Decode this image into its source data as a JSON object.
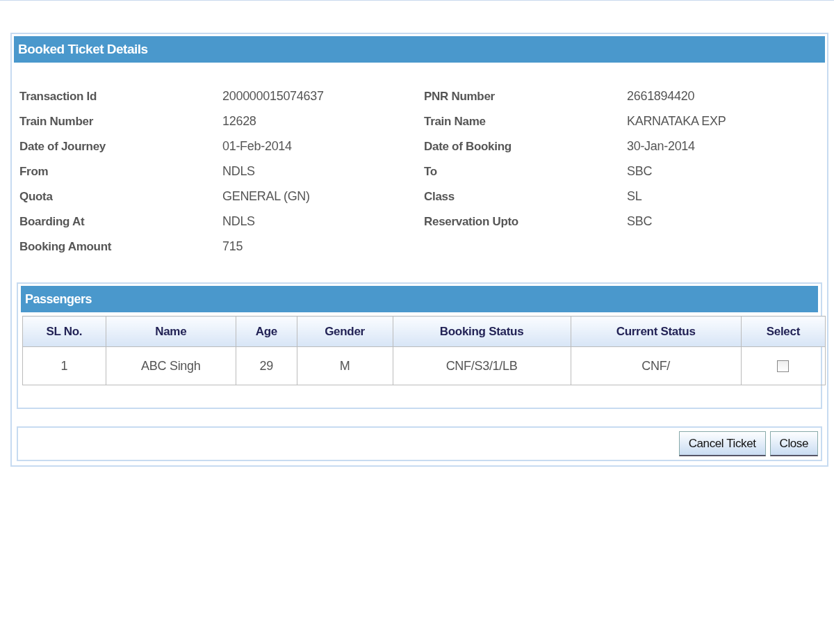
{
  "dialog": {
    "title": "Booked Ticket Details"
  },
  "details": [
    {
      "label": "Transaction Id",
      "value": "200000015074637"
    },
    {
      "label": "PNR Number",
      "value": "2661894420"
    },
    {
      "label": "Train Number",
      "value": "12628"
    },
    {
      "label": "Train Name",
      "value": "KARNATAKA EXP"
    },
    {
      "label": "Date of Journey",
      "value": "01-Feb-2014"
    },
    {
      "label": "Date of Booking",
      "value": "30-Jan-2014"
    },
    {
      "label": "From",
      "value": "NDLS"
    },
    {
      "label": "To",
      "value": "SBC"
    },
    {
      "label": "Quota",
      "value": "GENERAL (GN)"
    },
    {
      "label": "Class",
      "value": "SL"
    },
    {
      "label": "Boarding At",
      "value": "NDLS"
    },
    {
      "label": "Reservation Upto",
      "value": "SBC"
    },
    {
      "label": "Booking Amount",
      "value": "715"
    }
  ],
  "passengers": {
    "title": "Passengers",
    "columns": [
      "SL No.",
      "Name",
      "Age",
      "Gender",
      "Booking Status",
      "Current Status",
      "Select"
    ],
    "rows": [
      {
        "cells": [
          "1",
          "ABC Singh",
          "29",
          "M",
          "CNF/S3/1/LB",
          "CNF/"
        ],
        "checked": false
      }
    ]
  },
  "buttons": [
    "Cancel Ticket",
    "Close"
  ]
}
